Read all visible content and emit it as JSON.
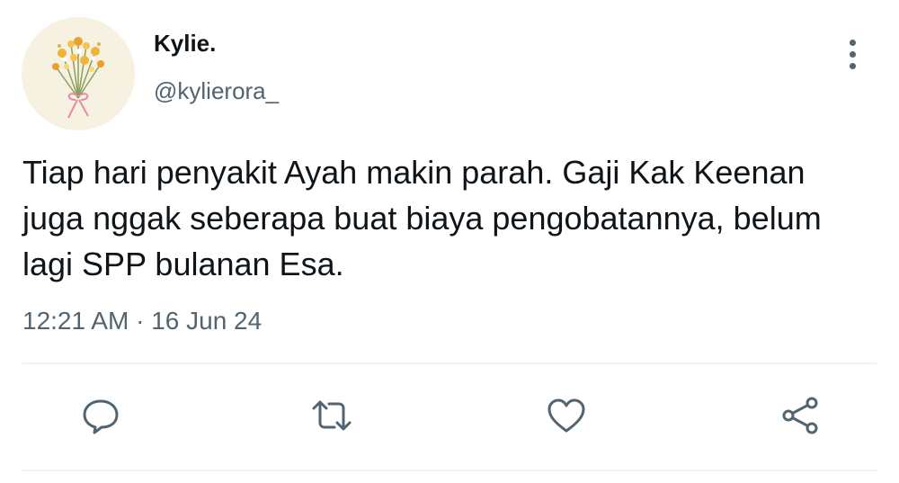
{
  "user": {
    "display_name": "Kylie.",
    "handle": "@kylierora_",
    "avatar_icon": "flower-bouquet-icon"
  },
  "tweet": {
    "text": "Tiap hari penyakit Ayah makin parah. Gaji Kak Keenan\njuga nggak seberapa buat biaya pengobatannya, belum\nlagi SPP bulanan Esa.",
    "time": "12:21 AM",
    "separator": "·",
    "date": "16 Jun 24"
  },
  "actions": [
    {
      "icon": "reply-icon"
    },
    {
      "icon": "retweet-icon"
    },
    {
      "icon": "like-icon"
    },
    {
      "icon": "share-icon"
    }
  ],
  "colors": {
    "primary_text": "#0f1419",
    "secondary_text": "#536471",
    "divider": "#eff3f4",
    "avatar_bg": "#f6f1e1"
  }
}
